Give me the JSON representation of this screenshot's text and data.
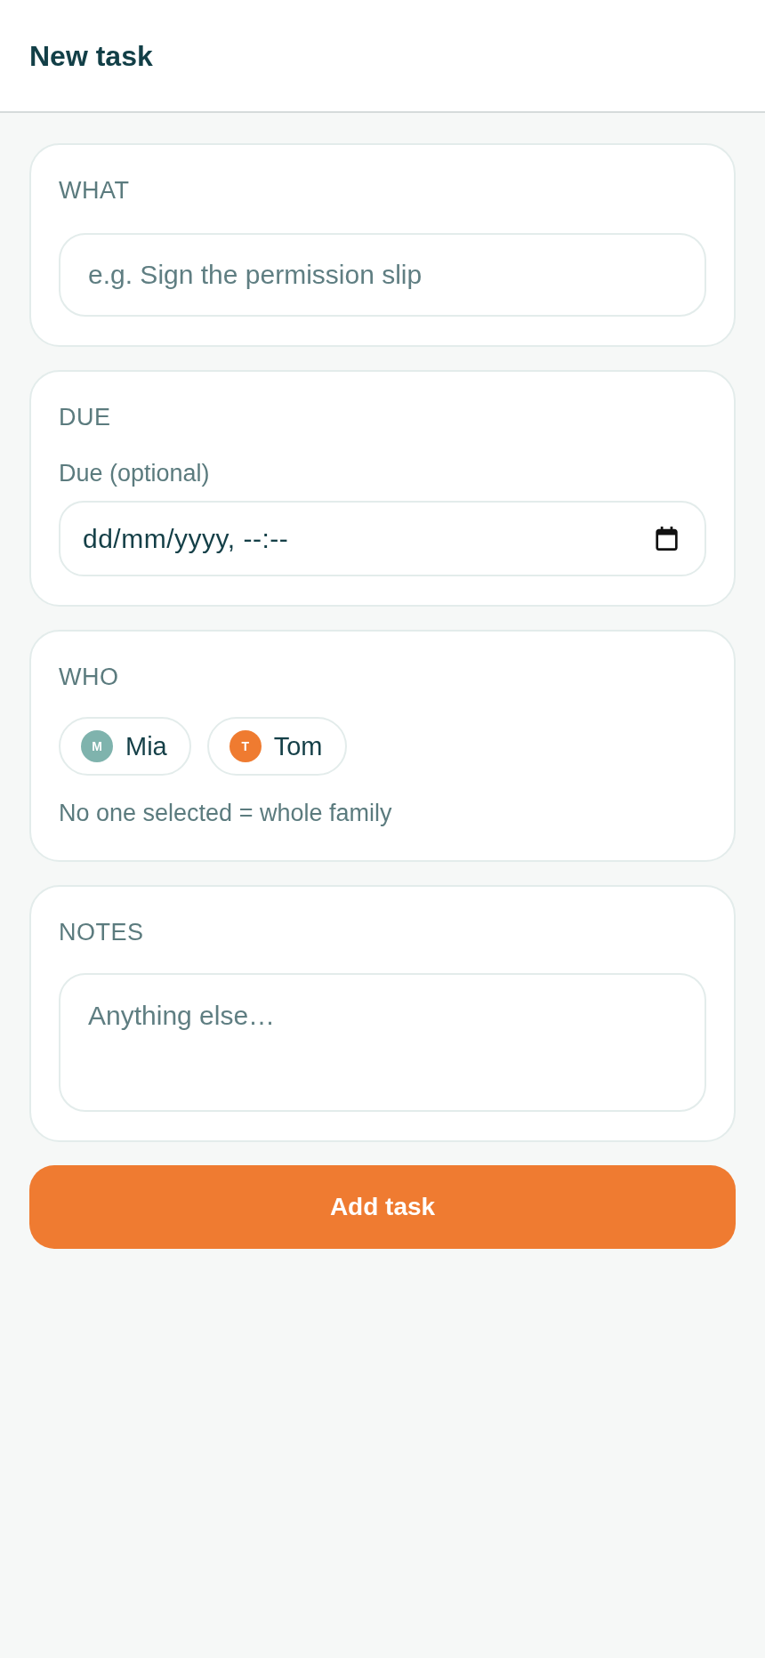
{
  "header": {
    "title": "New task"
  },
  "sections": [
    {
      "kind": "text",
      "label": "WHAT",
      "placeholder": "e.g. Sign the permission slip"
    },
    {
      "kind": "datetime",
      "label": "DUE",
      "field_label": "Due (optional)",
      "value": "dd/mm/yyyy, --:--"
    },
    {
      "kind": "people",
      "label": "WHO",
      "people": [
        {
          "name": "Mia",
          "initial": "M",
          "color": "#7fb3ad",
          "selected": false
        },
        {
          "name": "Tom",
          "initial": "T",
          "color": "#ef7b30",
          "selected": false
        }
      ],
      "hint": "No one selected = whole family"
    },
    {
      "kind": "textarea",
      "label": "NOTES",
      "placeholder": "Anything else…"
    }
  ],
  "submit_button": {
    "label": "Add task"
  }
}
